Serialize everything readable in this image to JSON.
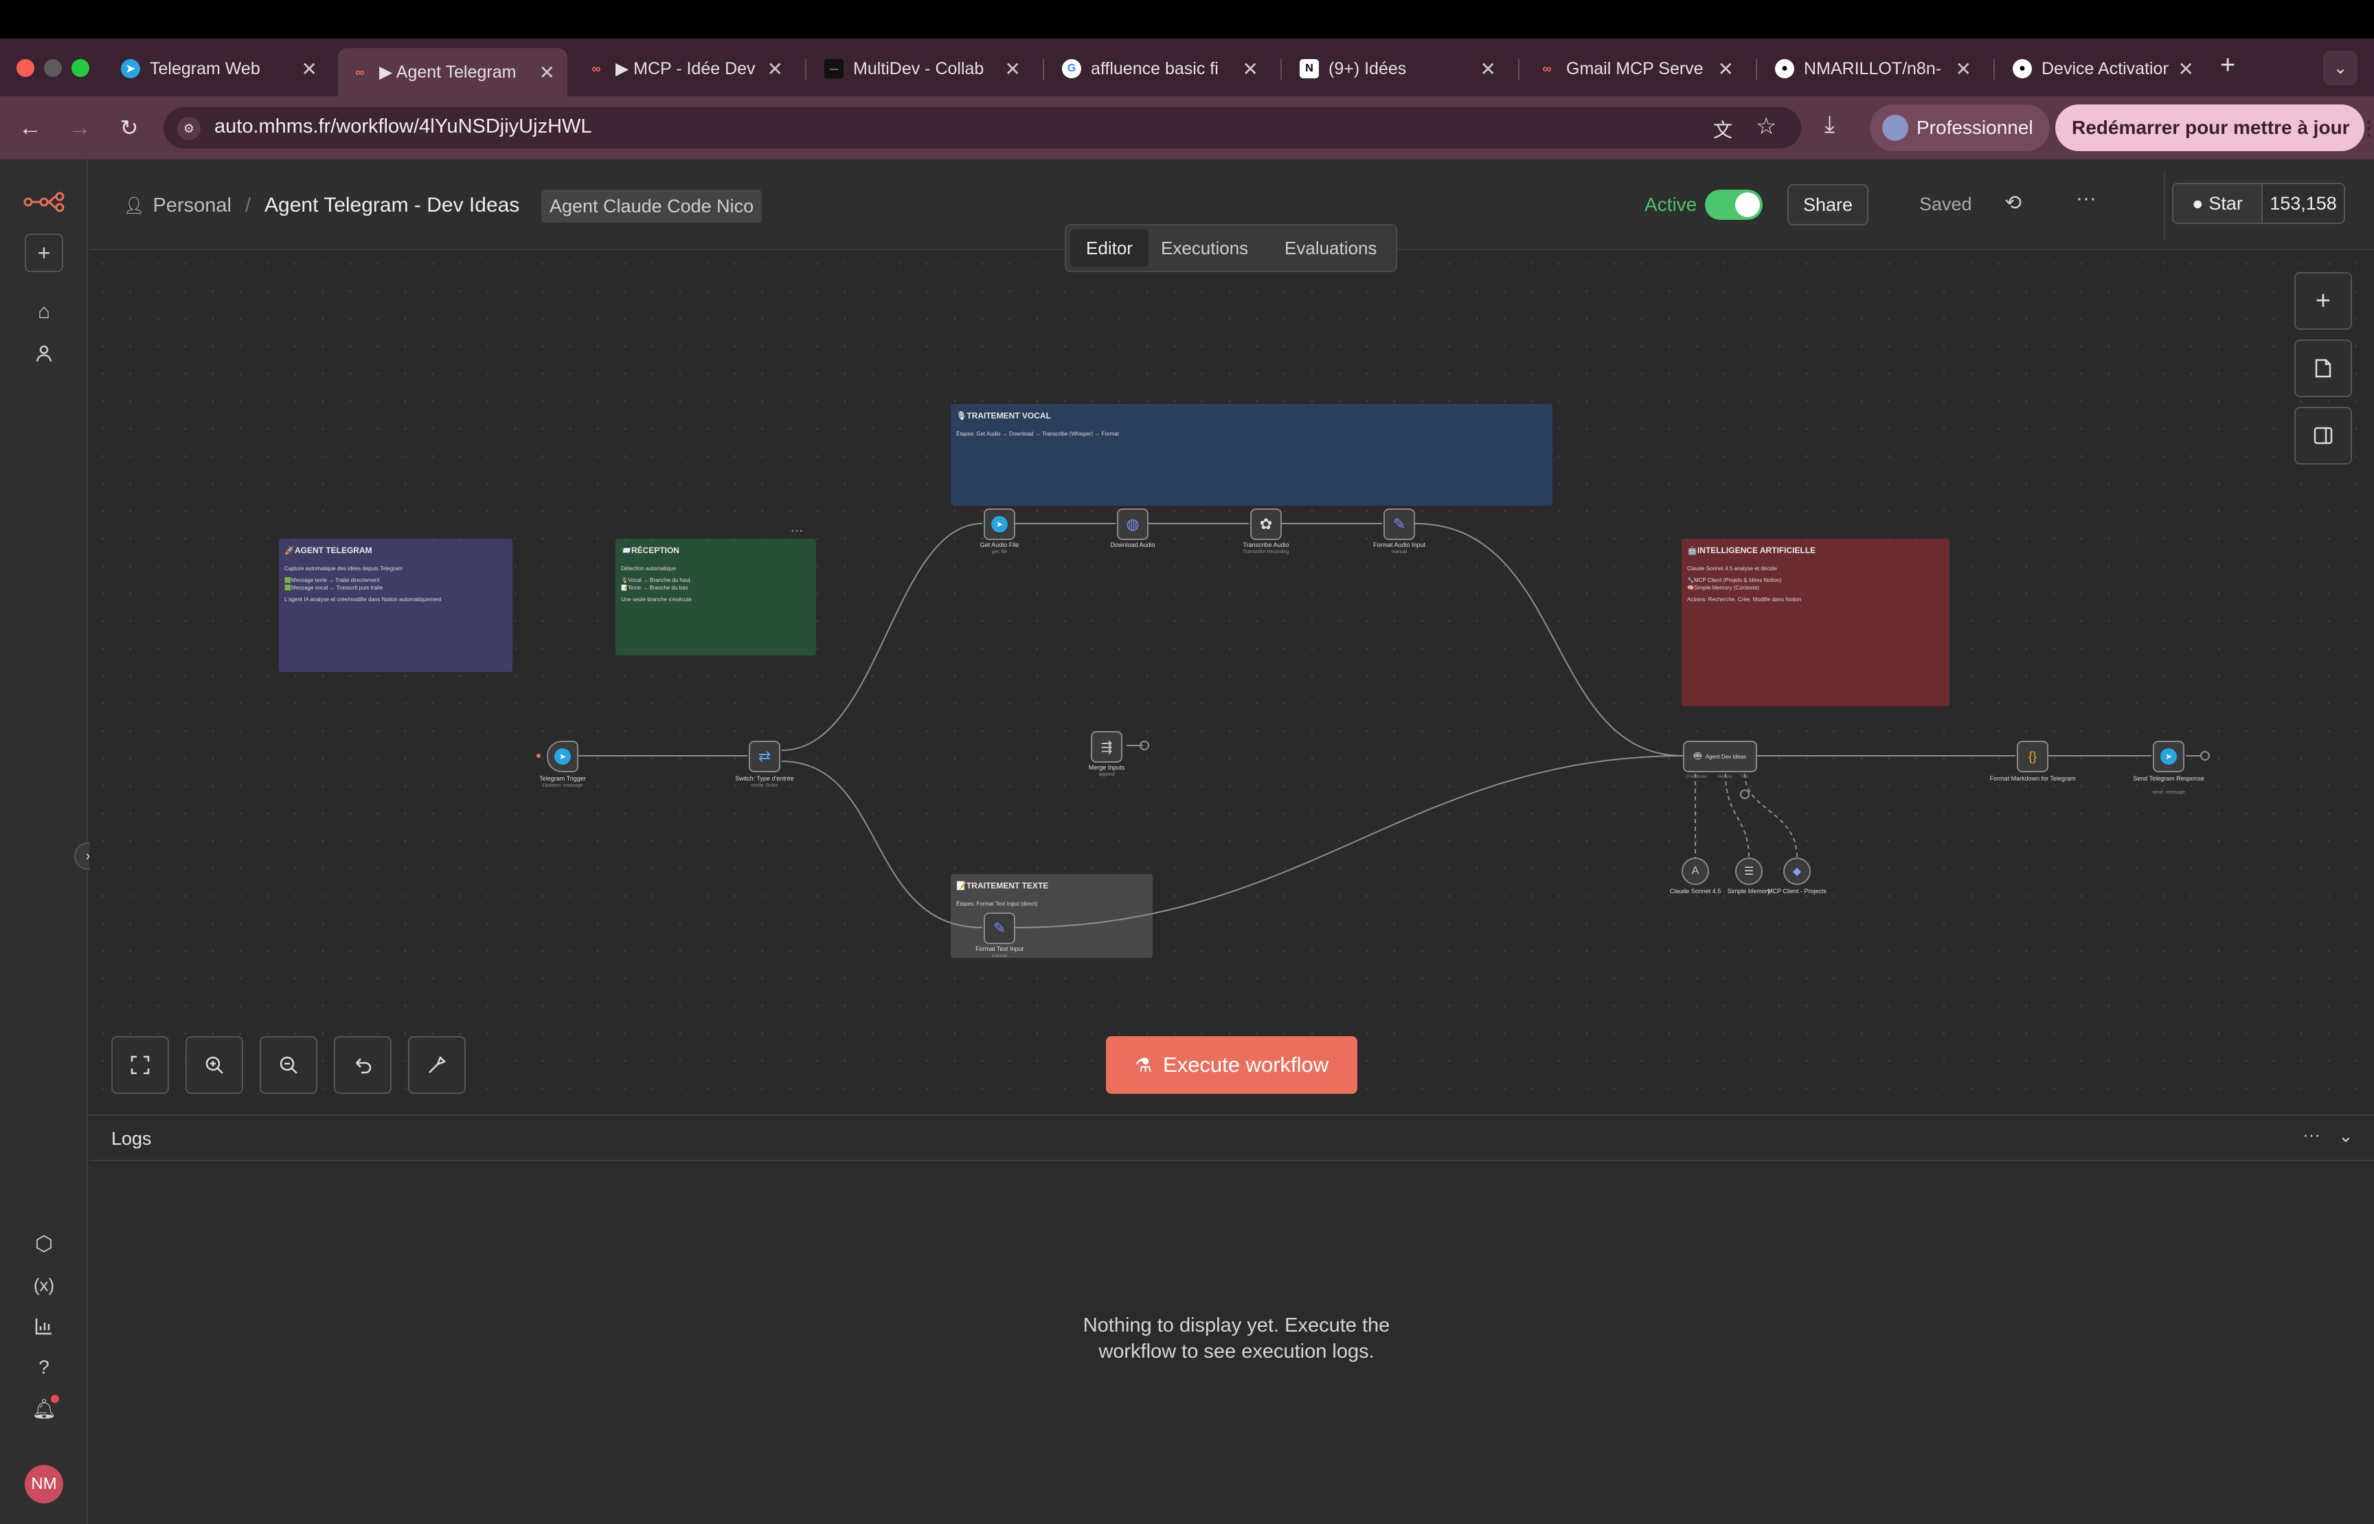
{
  "browser": {
    "tabs": [
      {
        "label": "Telegram Web",
        "icon": "telegram-icon"
      },
      {
        "label": "▶ Agent Telegram",
        "icon": "n8n-icon",
        "active": true
      },
      {
        "label": "▶ MCP - Idée Dev",
        "icon": "n8n-icon"
      },
      {
        "label": "MultiDev - Collab",
        "icon": "multidev-icon"
      },
      {
        "label": "affluence basic fi",
        "icon": "google-icon"
      },
      {
        "label": "(9+) Idées",
        "icon": "notion-icon"
      },
      {
        "label": "Gmail MCP Serve",
        "icon": "n8n-icon"
      },
      {
        "label": "NMARILLOT/n8n-",
        "icon": "github-icon"
      },
      {
        "label": "Device Activation",
        "icon": "github-icon"
      }
    ],
    "url": "auto.mhms.fr/workflow/4lYuNSDjiyUjzHWL",
    "profile_label": "Professionnel",
    "relaunch_label": "Redémarrer pour mettre à jour"
  },
  "header": {
    "breadcrumb_owner": "Personal",
    "breadcrumb_sep": "/",
    "workflow_name": "Agent Telegram - Dev Ideas",
    "tag": "Agent Claude Code Nico",
    "active_label": "Active",
    "share_label": "Share",
    "saved_label": "Saved",
    "star_label": "Star",
    "star_count": "153,158",
    "tabs": [
      "Editor",
      "Executions",
      "Evaluations"
    ],
    "selected_tab": "Editor"
  },
  "stickies": {
    "agent": {
      "title": "🚀AGENT TELEGRAM",
      "line1": "Capture automatique des idées depuis Telegram",
      "line2": "🟩Message texte → Traite directement",
      "line3": "🟩Message vocal → Transcrit puis traite",
      "line4": "L'agent IA analyse et crée/modifie dans Notion automatiquement"
    },
    "reception": {
      "title": "📨RÉCEPTION",
      "line1": "Détection automatique",
      "line2": "🎙Vocal → Branche du haut",
      "line3": "📝Texte → Branche du bas",
      "line4": "Une seule branche s'exécute"
    },
    "vocal": {
      "title": "🎙TRAITEMENT VOCAL",
      "line1": "Étapes: Get Audio → Download → Transcribe (Whisper) → Format"
    },
    "ia": {
      "title": "🤖INTELLIGENCE ARTIFICIELLE",
      "line1": "Claude Sonnet 4.5 analyse et décide",
      "line2": "🔧MCP Client (Projets & Idées Notion)",
      "line3": "🧠Simple Memory (Contexte)",
      "line4": "Actions: Recherche, Crée, Modifie dans Notion"
    },
    "texte": {
      "title": "📝TRAITEMENT TEXTE",
      "line1": "Étapes: Format Text Input (direct)"
    }
  },
  "nodes": {
    "telegram_trigger": {
      "label": "Telegram Trigger",
      "sub": "Updates: message"
    },
    "switch": {
      "label": "Switch: Type d'entrée",
      "sub": "mode: Rules"
    },
    "get_audio": {
      "label": "Get Audio File",
      "sub": "get: file"
    },
    "download_audio": {
      "label": "Download Audio",
      "sub": ""
    },
    "transcribe": {
      "label": "Transcribe Audio",
      "sub": "Transcribe Recording"
    },
    "format_audio": {
      "label": "Format Audio Input",
      "sub": "manual"
    },
    "merge": {
      "label": "Merge Inputs",
      "sub": "append"
    },
    "format_text": {
      "label": "Format Text Input",
      "sub": "manual"
    },
    "agent": {
      "label": "Agent Dev Ideas",
      "sub": ""
    },
    "agent_ports": {
      "model": "Chat Model",
      "memory": "Memory",
      "tool": "Tool"
    },
    "format_md": {
      "label": "Format Markdown for Telegram",
      "sub": ""
    },
    "send_tg": {
      "label": "Send Telegram Response",
      "sub": "send: message"
    },
    "claude": {
      "label": "Claude Sonnet 4.5",
      "sub": ""
    },
    "memory": {
      "label": "Simple Memory",
      "sub": ""
    },
    "mcp": {
      "label": "MCP Client - Projects",
      "sub": ""
    }
  },
  "canvas_controls": {
    "execute_label": "Execute workflow"
  },
  "logs": {
    "title": "Logs",
    "empty_line1": "Nothing to display yet. Execute the",
    "empty_line2": "workflow to see execution logs."
  },
  "user": {
    "initials": "NM"
  },
  "colors": {
    "accent": "#ea6f5e",
    "active_toggle": "#4cc56c",
    "sticky_agent": "#3f3d66",
    "sticky_reception": "#294f39",
    "sticky_vocal": "#2a3f5c",
    "sticky_ia": "#6b2b2f",
    "sticky_texte": "#484848"
  }
}
